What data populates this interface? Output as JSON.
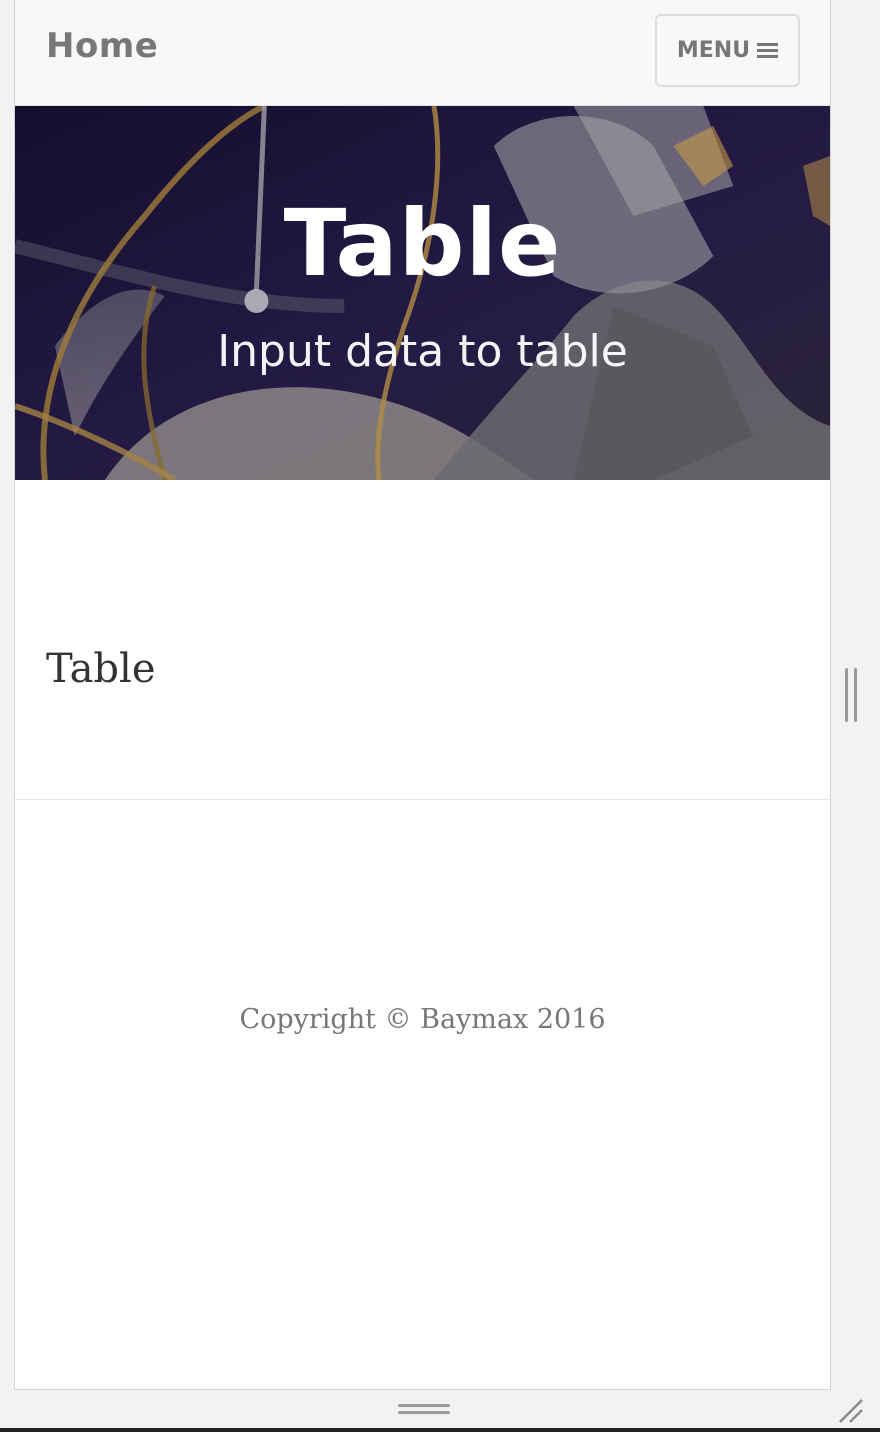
{
  "navbar": {
    "brand": "Home",
    "menu_label": "MENU",
    "menu_icon": "hamburger-icon"
  },
  "hero": {
    "title": "Table",
    "subtitle": "Input data to table",
    "background_image": "astronaut-spacewalk-photo"
  },
  "content": {
    "heading": "Table"
  },
  "footer": {
    "copyright": "Copyright © Baymax 2016"
  },
  "colors": {
    "navbar_bg": "#f8f8f8",
    "nav_text": "#777777",
    "hero_tint": "#1d1638",
    "body_text": "#333333",
    "footer_text": "#777777"
  }
}
